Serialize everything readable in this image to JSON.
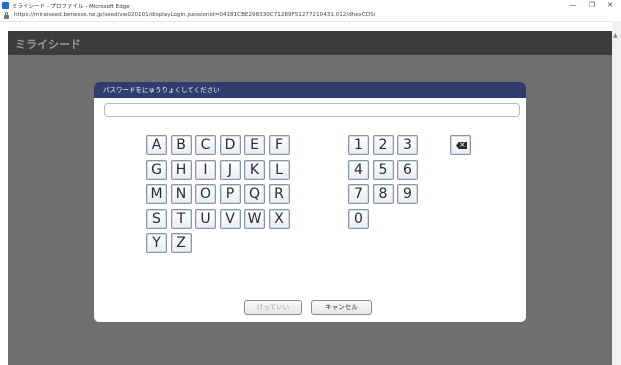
{
  "browser": {
    "window_title": "ミライシード - プロファイル - Microsoft Edge",
    "url": "https://miraiseed.benesse.ne.jp/seed/vw020101/displayLogin.jsessionid=04181CBE298330C71289F51277210431.012/dhexCDSi",
    "controls": {
      "minimize": "—",
      "maximize": "❐",
      "close": "✕"
    }
  },
  "app": {
    "logo": "ミライシード"
  },
  "dialog": {
    "title": "パスワードをにゅうりょくしてください",
    "password_value": "",
    "keys_letters": [
      [
        "A",
        "B",
        "C",
        "D",
        "E",
        "F"
      ],
      [
        "G",
        "H",
        "I",
        "J",
        "K",
        "L"
      ],
      [
        "M",
        "N",
        "O",
        "P",
        "Q",
        "R"
      ],
      [
        "S",
        "T",
        "U",
        "V",
        "W",
        "X"
      ],
      [
        "Y",
        "Z"
      ]
    ],
    "keys_digits": [
      [
        "1",
        "2",
        "3"
      ],
      [
        "4",
        "5",
        "6"
      ],
      [
        "7",
        "8",
        "9"
      ],
      [
        "0"
      ]
    ],
    "ok_label": "けっていい",
    "cancel_label": "キャンセル"
  },
  "colors": {
    "dialog_header": "#2e3d6e",
    "overlay": "#6f6f6f",
    "app_header": "#3c3c3c"
  }
}
